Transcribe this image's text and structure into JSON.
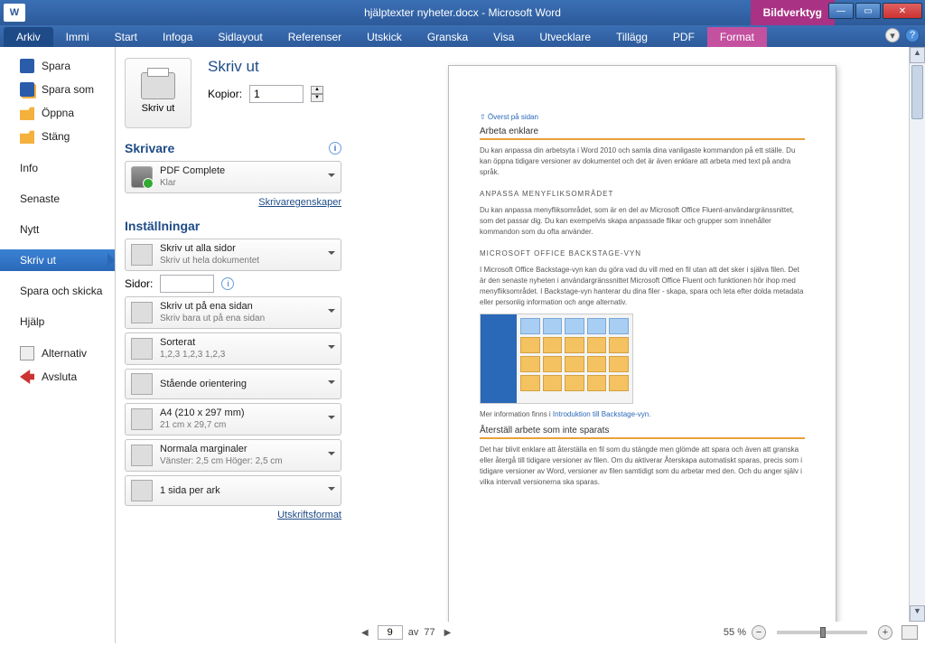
{
  "titlebar": {
    "app_icon_letter": "W",
    "title": "hjälptexter nyheter.docx  -  Microsoft Word",
    "tool_tab": "Bildverktyg"
  },
  "ribbon": {
    "tabs": [
      "Arkiv",
      "Immi",
      "Start",
      "Infoga",
      "Sidlayout",
      "Referenser",
      "Utskick",
      "Granska",
      "Visa",
      "Utvecklare",
      "Tillägg",
      "PDF",
      "Format"
    ],
    "active": "Arkiv",
    "pink_active": "Format"
  },
  "sidebar": {
    "items": [
      {
        "label": "Spara",
        "icon": "save"
      },
      {
        "label": "Spara som",
        "icon": "saveas"
      },
      {
        "label": "Öppna",
        "icon": "open"
      },
      {
        "label": "Stäng",
        "icon": "close"
      },
      {
        "label": "Info",
        "icon": ""
      },
      {
        "label": "Senaste",
        "icon": ""
      },
      {
        "label": "Nytt",
        "icon": ""
      },
      {
        "label": "Skriv ut",
        "icon": "",
        "selected": true
      },
      {
        "label": "Spara och skicka",
        "icon": ""
      },
      {
        "label": "Hjälp",
        "icon": ""
      },
      {
        "label": "Alternativ",
        "icon": "opts"
      },
      {
        "label": "Avsluta",
        "icon": "exit"
      }
    ]
  },
  "print": {
    "heading": "Skriv ut",
    "button": "Skriv ut",
    "copies_label": "Kopior:",
    "copies_value": "1",
    "printer_heading": "Skrivare",
    "printer_name": "PDF Complete",
    "printer_status": "Klar",
    "printer_props": "Skrivaregenskaper",
    "settings_heading": "Inställningar",
    "pages_label": "Sidor:",
    "pages_value": "",
    "print_format": "Utskriftsformat",
    "dd": {
      "range": {
        "main": "Skriv ut alla sidor",
        "sub": "Skriv ut hela dokumentet"
      },
      "sides": {
        "main": "Skriv ut på ena sidan",
        "sub": "Skriv bara ut på ena sidan"
      },
      "collate": {
        "main": "Sorterat",
        "sub": "1,2,3    1,2,3    1,2,3"
      },
      "orient": {
        "main": "Stående orientering",
        "sub": ""
      },
      "size": {
        "main": "A4 (210 x 297 mm)",
        "sub": "21 cm x 29,7 cm"
      },
      "margins": {
        "main": "Normala marginaler",
        "sub": "Vänster:  2,5 cm    Höger:  2,5 cm"
      },
      "perpage": {
        "main": "1 sida per ark",
        "sub": ""
      }
    }
  },
  "pagecontent": {
    "toplink": "⇧ Överst på sidan",
    "h1": "Arbeta enklare",
    "p1": "Du kan anpassa din arbetsyta i Word 2010 och samla dina vanligaste kommandon på ett ställe. Du kan öppna tidigare versioner av dokumentet och det är även enklare att arbeta med text på andra språk.",
    "s1": "ANPASSA  MENYFLIKSOMRÅDET",
    "p2": "Du kan anpassa menyfliksområdet, som är en del av Microsoft Office Fluent-användargränssnittet, som det passar dig. Du kan exempelvis skapa anpassade flikar och grupper som innehåller kommandon som du ofta använder.",
    "s2": "MICROSOFT  OFFICE  BACKSTAGE-VYN",
    "p3": "I Microsoft Office Backstage-vyn kan du göra vad du vill med en fil utan att det sker i själva filen. Det är den senaste nyheten i användargränssnittet Microsoft Office Fluent och funktionen hör ihop med menyfliksområdet. I Backstage-vyn hanterar du dina filer - skapa, spara och leta efter dolda metadata eller personlig information och ange alternativ.",
    "more": "Mer information finns i ",
    "morelink": "Introduktion till Backstage-vyn.",
    "h2": "Återställ arbete som inte sparats",
    "p4": "Det har blivit enklare att återställa en fil som du stängde men glömde att spara och även att granska eller återgå till tidigare versioner av filen. Om du aktiverar Återskapa automatiskt sparas, precis som i tidigare versioner av Word, versioner av filen samtidigt som du arbetar med den. Och du anger själv i vilka intervall versionerna ska sparas."
  },
  "status": {
    "page": "9",
    "of_label": "av",
    "total": "77",
    "zoom": "55 %"
  }
}
